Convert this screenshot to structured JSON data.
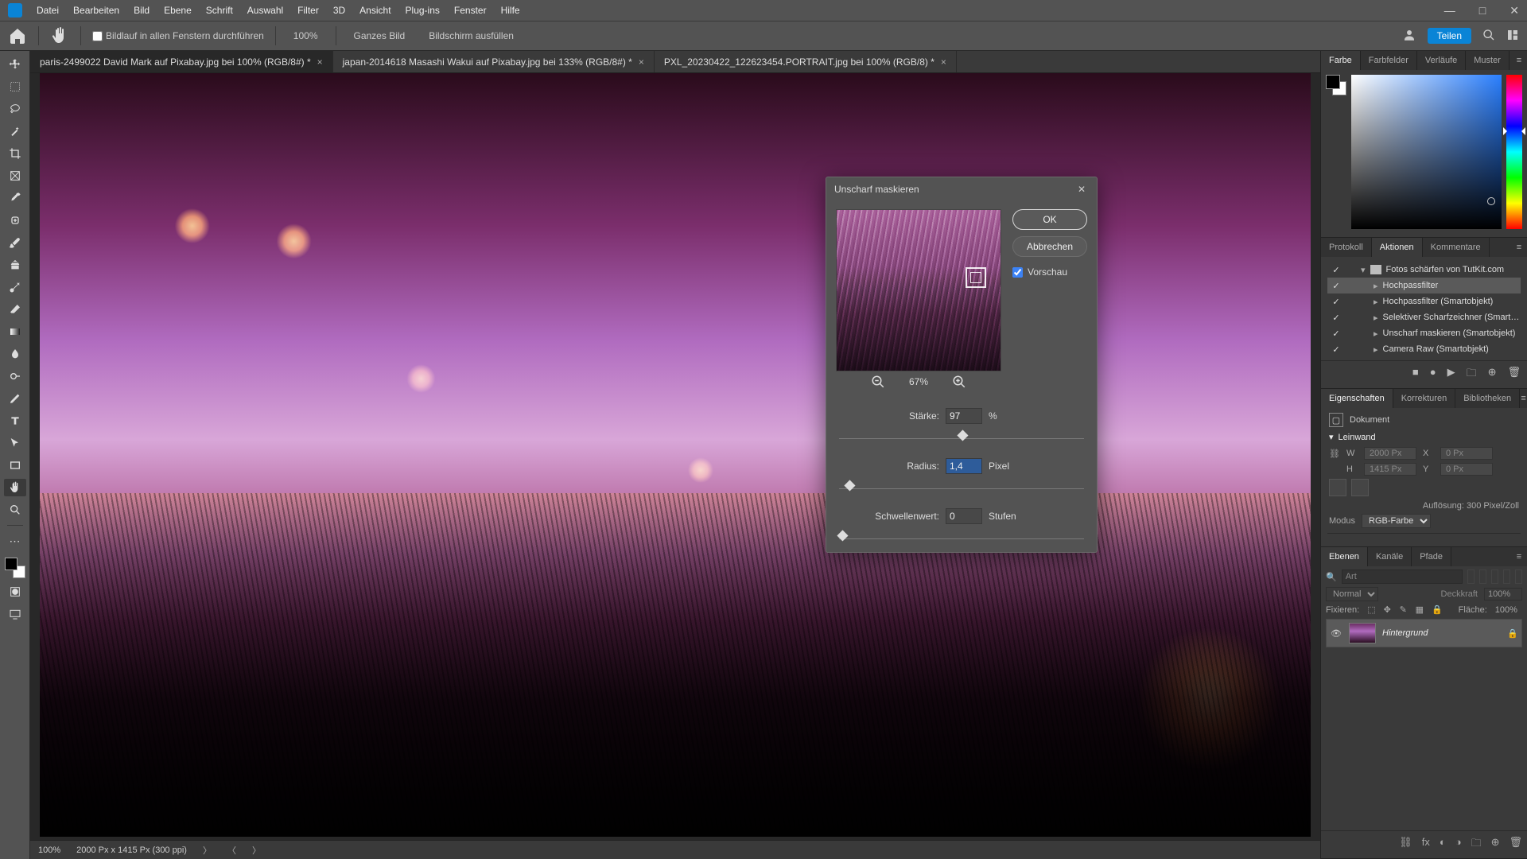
{
  "menu": {
    "items": [
      "Datei",
      "Bearbeiten",
      "Bild",
      "Ebene",
      "Schrift",
      "Auswahl",
      "Filter",
      "3D",
      "Ansicht",
      "Plug-ins",
      "Fenster",
      "Hilfe"
    ]
  },
  "window_controls": {
    "min": "—",
    "max": "□",
    "close": "✕"
  },
  "options": {
    "scroll_all_label": "Bildlauf in allen Fenstern durchführen",
    "zoom": "100%",
    "fit_btn": "Ganzes Bild",
    "fill_btn": "Bildschirm ausfüllen",
    "share": "Teilen"
  },
  "tabs": [
    {
      "label": "paris-2499022  David Mark auf Pixabay.jpg bei 100% (RGB/8#) *",
      "active": true
    },
    {
      "label": "japan-2014618 Masashi Wakui auf Pixabay.jpg bei 133% (RGB/8#) *",
      "active": false
    },
    {
      "label": "PXL_20230422_122623454.PORTRAIT.jpg bei 100% (RGB/8) *",
      "active": false
    }
  ],
  "status": {
    "zoom": "100%",
    "docinfo": "2000 Px x 1415 Px (300 ppi)"
  },
  "dialog": {
    "title": "Unscharf maskieren",
    "ok": "OK",
    "cancel": "Abbrechen",
    "preview": "Vorschau",
    "zoom": "67%",
    "amount_label": "Stärke:",
    "amount_value": "97",
    "amount_unit": "%",
    "radius_label": "Radius:",
    "radius_value": "1,4",
    "radius_unit": "Pixel",
    "threshold_label": "Schwellenwert:",
    "threshold_value": "0",
    "threshold_unit": "Stufen"
  },
  "right": {
    "color_tabs": [
      "Farbe",
      "Farbfelder",
      "Verläufe",
      "Muster"
    ],
    "history_tabs": [
      "Protokoll",
      "Aktionen",
      "Kommentare"
    ],
    "actions": {
      "set": "Fotos schärfen von TutKit.com",
      "items": [
        "Hochpassfilter",
        "Hochpassfilter (Smartobjekt)",
        "Selektiver Scharfzeichner (Smarto...",
        "Unscharf maskieren (Smartobjekt)",
        "Camera Raw (Smartobjekt)"
      ]
    },
    "props_tabs": [
      "Eigenschaften",
      "Korrekturen",
      "Bibliotheken"
    ],
    "props": {
      "doc_label": "Dokument",
      "canvas_label": "Leinwand",
      "w_label": "W",
      "w_val": "2000 Px",
      "h_label": "H",
      "h_val": "1415 Px",
      "x_label": "X",
      "x_val": "0 Px",
      "y_label": "Y",
      "y_val": "0 Px",
      "res_label": "Auflösung: 300 Pixel/Zoll",
      "mode_label": "Modus",
      "mode_value": "RGB-Farbe"
    },
    "layers_tabs": [
      "Ebenen",
      "Kanäle",
      "Pfade"
    ],
    "layers": {
      "filter_label": "Art",
      "blend": "Normal",
      "opacity_label": "Deckkraft",
      "opacity": "100%",
      "lock_label": "Fixieren:",
      "fill_label": "Fläche:",
      "fill": "100%",
      "layer_name": "Hintergrund"
    }
  }
}
